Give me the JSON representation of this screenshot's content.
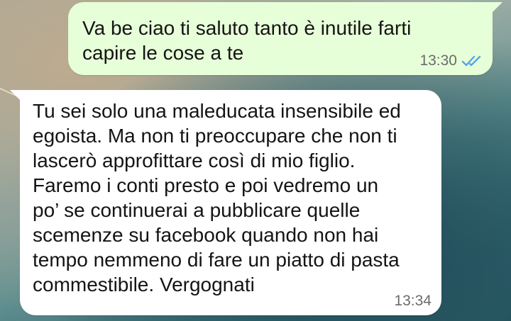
{
  "messages": [
    {
      "direction": "outgoing",
      "text": "Va be ciao ti saluto tanto è inutile farti\ncapire le cose a te",
      "time": "13:30",
      "status_icon": "double-check-read-icon",
      "status_color": "#53a6e8"
    },
    {
      "direction": "incoming",
      "text": "Tu sei solo una maleducata insensibile ed\negoista. Ma non ti preoccupare che non ti\nlascerò approfittare così di mio figlio.\nFaremo i conti presto e poi vedremo un\npo’ se continuerai a pubblicare quelle\nscemenze su facebook quando non hai\ntempo nemmeno di fare un piatto di pasta\ncommestibile. Vergognati",
      "time": "13:34"
    }
  ],
  "colors": {
    "outgoing_bubble": "#e7ffd9",
    "incoming_bubble": "#ffffff",
    "text": "#141414",
    "timestamp": "#6b6b6b"
  }
}
